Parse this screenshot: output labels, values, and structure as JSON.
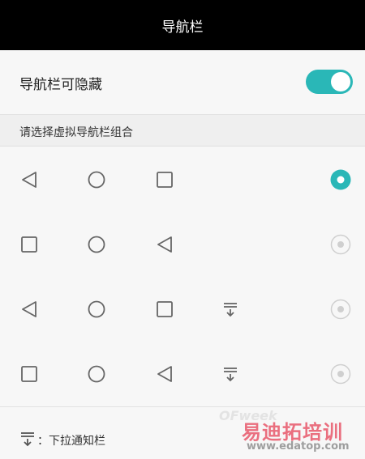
{
  "header": {
    "title": "导航栏"
  },
  "hide_setting": {
    "label": "导航栏可隐藏",
    "enabled": true,
    "accent_color": "#2ab7b7"
  },
  "section": {
    "title": "请选择虚拟导航栏组合"
  },
  "options": [
    {
      "icons": [
        "back-icon",
        "home-icon",
        "recent-apps-icon"
      ],
      "selected": true
    },
    {
      "icons": [
        "recent-apps-icon",
        "home-icon",
        "back-icon"
      ],
      "selected": false
    },
    {
      "icons": [
        "back-icon",
        "home-icon",
        "recent-apps-icon",
        "pull-down-notification-icon"
      ],
      "selected": false
    },
    {
      "icons": [
        "recent-apps-icon",
        "home-icon",
        "back-icon",
        "pull-down-notification-icon"
      ],
      "selected": false
    }
  ],
  "legend": {
    "icon": "pull-down-notification-icon",
    "text": "：下拉通知栏"
  },
  "watermark": {
    "brand_en": "OFweek",
    "brand_cn": "易迪拓培训",
    "url": "www.edatop.com"
  }
}
